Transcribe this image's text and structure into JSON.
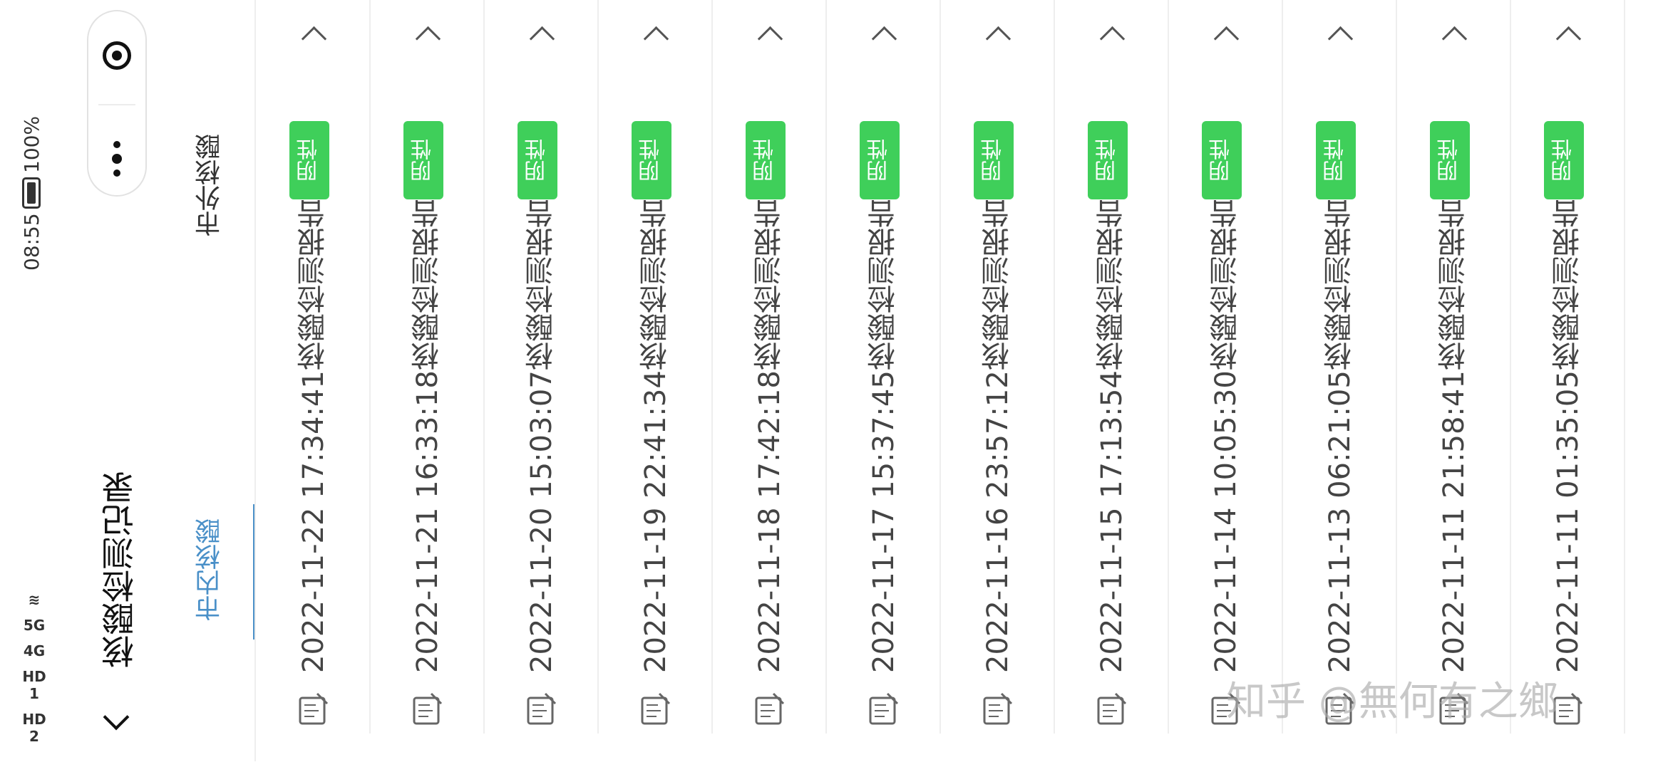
{
  "status_bar": {
    "time": "08:55",
    "battery": "100%",
    "carrier_labels": [
      "HD 1",
      "4G",
      "5G",
      "HD 2"
    ]
  },
  "header": {
    "title": "核酸检测记录"
  },
  "tabs": [
    {
      "label": "市内核酸",
      "active": true
    },
    {
      "label": "市外核酸",
      "active": false
    }
  ],
  "reports": [
    {
      "title": "2022-11-22 17:34:41核酸检测报告",
      "result": "阴性"
    },
    {
      "title": "2022-11-21 16:33:18核酸检测报告",
      "result": "阴性"
    },
    {
      "title": "2022-11-20 15:03:07核酸检测报告",
      "result": "阴性"
    },
    {
      "title": "2022-11-19 22:41:34核酸检测报告",
      "result": "阴性"
    },
    {
      "title": "2022-11-18 17:42:18核酸检测报告",
      "result": "阴性"
    },
    {
      "title": "2022-11-17 15:37:45核酸检测报告",
      "result": "阴性"
    },
    {
      "title": "2022-11-16 23:57:12核酸检测报告",
      "result": "阴性"
    },
    {
      "title": "2022-11-15 17:13:54核酸检测报告",
      "result": "阴性"
    },
    {
      "title": "2022-11-14 10:05:30核酸检测报告",
      "result": "阴性"
    },
    {
      "title": "2022-11-13 06:21:05核酸检测报告",
      "result": "阴性"
    },
    {
      "title": "2022-11-11 21:58:41核酸检测报告",
      "result": "阴性"
    },
    {
      "title": "2022-11-11 01:35:05核酸检测报告",
      "result": "阴性"
    }
  ],
  "watermark": "知乎 @無何有之鄉",
  "colors": {
    "accent": "#4a90c8",
    "badge": "#3fcf5a"
  }
}
